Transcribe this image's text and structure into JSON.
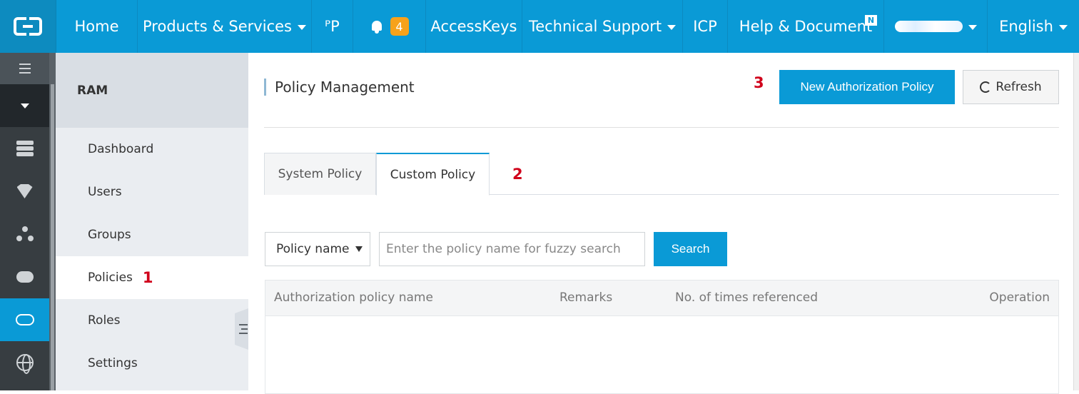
{
  "topnav": {
    "home": "Home",
    "products": "Products & Services",
    "p_fragment": "ᴾP",
    "notification_count": "4",
    "accesskeys": "AccessKeys",
    "technical_support": "Technical Support",
    "icp": "ICP",
    "help": "Help & Document",
    "help_badge": "N",
    "language": "English"
  },
  "rail": {
    "icons": [
      "menu-icon",
      "dropdown-icon",
      "database-icon",
      "shield-icon",
      "nodes-icon",
      "cloud-icon",
      "cloud-outline-icon",
      "globe-icon"
    ],
    "active_color": "#0a9ad6"
  },
  "sidebar": {
    "title": "RAM",
    "items": [
      {
        "label": "Dashboard"
      },
      {
        "label": "Users"
      },
      {
        "label": "Groups"
      },
      {
        "label": "Policies",
        "annotation": "1"
      },
      {
        "label": "Roles"
      },
      {
        "label": "Settings"
      }
    ]
  },
  "main": {
    "title": "Policy Management",
    "annotation_new": "3",
    "new_policy_button": "New Authorization Policy",
    "refresh_button": "Refresh",
    "tabs": [
      {
        "label": "System Policy"
      },
      {
        "label": "Custom Policy"
      }
    ],
    "annotation_tab": "2",
    "filter_select": "Policy name",
    "search_placeholder": "Enter the policy name for fuzzy search",
    "search_button": "Search",
    "table_headers": [
      "Authorization policy name",
      "Remarks",
      "No. of times referenced",
      "Operation"
    ]
  },
  "colors": {
    "brand": "#0a9ad6",
    "annotation": "#d0021b",
    "badge": "#f7a21b"
  }
}
